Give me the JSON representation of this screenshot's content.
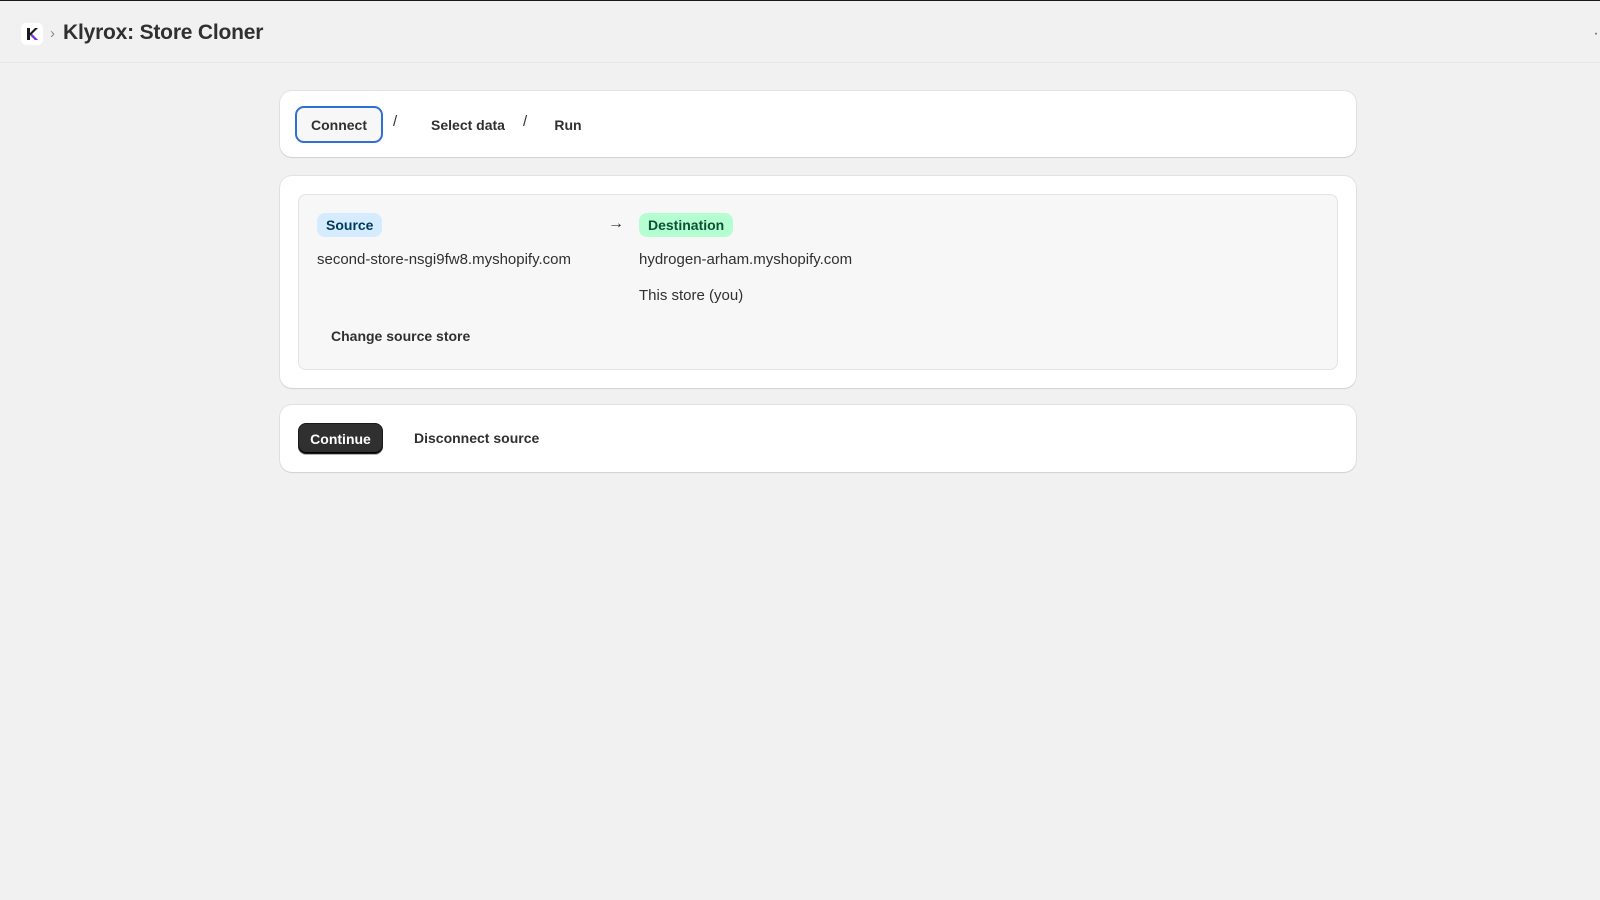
{
  "header": {
    "title": "Klyrox: Store Cloner",
    "breadcrumb_separator": "›",
    "more_icon": "more-horizontal-icon",
    "more_glyph": "··"
  },
  "steps": {
    "items": [
      {
        "label": "Connect",
        "active": true
      },
      {
        "label": "Select data",
        "active": false
      },
      {
        "label": "Run",
        "active": false
      }
    ],
    "separator": "/"
  },
  "connection": {
    "source_badge": "Source",
    "source_store": "second-store-nsgi9fw8.myshopify.com",
    "arrow_icon": "arrow-right-icon",
    "arrow_glyph": "→",
    "destination_badge": "Destination",
    "destination_store": "hydrogen-arham.myshopify.com",
    "destination_note": "This store (you)",
    "change_source_label": "Change source store"
  },
  "actions": {
    "continue_label": "Continue",
    "disconnect_label": "Disconnect source"
  },
  "colors": {
    "accent_focus": "#2f6fd8",
    "source_badge_bg": "#d5ebff",
    "destination_badge_bg": "#b4fed2",
    "primary_button": "#303030"
  }
}
